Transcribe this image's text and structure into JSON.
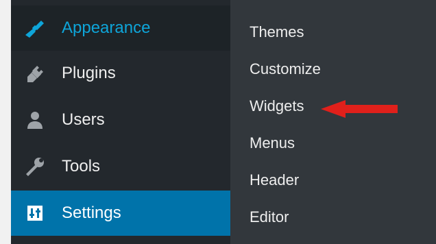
{
  "sidebar": {
    "items": [
      {
        "label": "Appearance",
        "icon": "paintbrush-icon",
        "active": true
      },
      {
        "label": "Plugins",
        "icon": "plugin-plug-icon"
      },
      {
        "label": "Users",
        "icon": "user-icon"
      },
      {
        "label": "Tools",
        "icon": "wrench-icon"
      },
      {
        "label": "Settings",
        "icon": "settings-sliders-icon",
        "highlighted": true
      }
    ]
  },
  "submenu": {
    "items": [
      {
        "label": "Themes"
      },
      {
        "label": "Customize"
      },
      {
        "label": "Widgets",
        "annotated": true
      },
      {
        "label": "Menus"
      },
      {
        "label": "Header"
      },
      {
        "label": "Editor"
      }
    ]
  },
  "annotation": {
    "icon": "red-arrow-icon",
    "color": "#e0201b"
  },
  "colors": {
    "sidebar_bg": "#23282d",
    "submenu_bg": "#32373c",
    "accent_blue": "#0073aa",
    "active_text": "#0ea5d9"
  }
}
